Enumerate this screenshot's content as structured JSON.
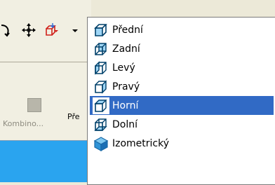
{
  "toolbar": {
    "icons": [
      "rotate-icon",
      "pan-move-icon",
      "view-cube-dropdown-icon",
      "dropdown-arrow-icon"
    ],
    "kombino_label": "Kombino...",
    "pre_label": "Pře"
  },
  "menu": {
    "items": [
      {
        "label": "Přední",
        "icon": "view-cube-front-icon"
      },
      {
        "label": "Zadní",
        "icon": "view-cube-back-icon"
      },
      {
        "label": "Levý",
        "icon": "view-cube-left-icon"
      },
      {
        "label": "Pravý",
        "icon": "view-cube-right-icon"
      },
      {
        "label": "Horní",
        "icon": "view-cube-top-icon",
        "selected": true
      },
      {
        "label": "Dolní",
        "icon": "view-cube-bottom-icon"
      },
      {
        "label": "Izometrický",
        "icon": "isometric-cube-icon"
      }
    ]
  },
  "colors": {
    "menu_highlight": "#316ac5",
    "panel_blue": "#2aa4ef",
    "toolbar_bg": "#f1efe2"
  }
}
